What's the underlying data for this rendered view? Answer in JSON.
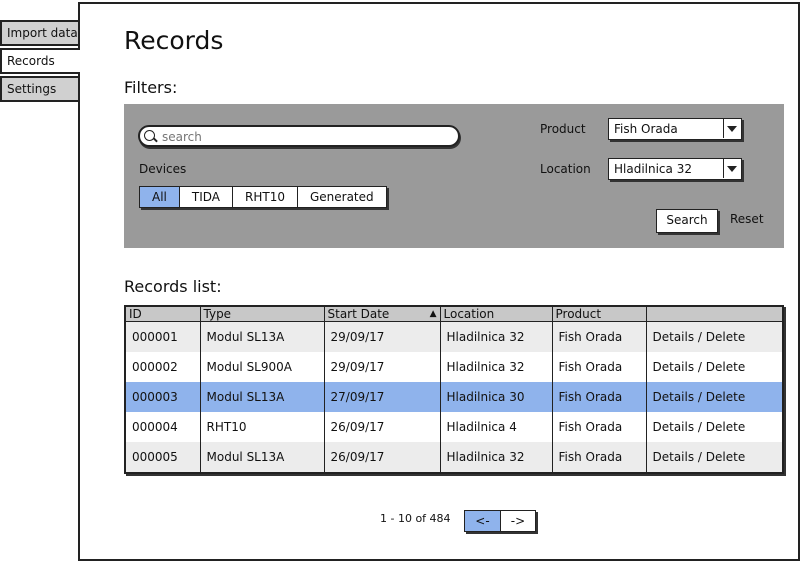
{
  "nav": {
    "tabs": [
      {
        "label": "Import data"
      },
      {
        "label": "Records"
      },
      {
        "label": "Settings"
      }
    ]
  },
  "page": {
    "title": "Records"
  },
  "filters": {
    "heading": "Filters:",
    "search_placeholder": "search",
    "devices_label": "Devices",
    "devices": [
      "All",
      "TIDA",
      "RHT10",
      "Generated"
    ],
    "product_label": "Product",
    "product_value": "Fish Orada",
    "location_label": "Location",
    "location_value": "Hladilnica 32",
    "search_button": "Search",
    "reset_button": "Reset"
  },
  "records": {
    "heading": "Records list:",
    "columns": [
      "ID",
      "Type",
      "Start Date",
      "Location",
      "Product",
      ""
    ],
    "rows": [
      {
        "id": "000001",
        "type": "Modul SL13A",
        "start": "29/09/17",
        "location": "Hladilnica 32",
        "product": "Fish Orada",
        "actions": "Details / Delete"
      },
      {
        "id": "000002",
        "type": "Modul SL900A",
        "start": "29/09/17",
        "location": "Hladilnica 32",
        "product": "Fish Orada",
        "actions": "Details / Delete"
      },
      {
        "id": "000003",
        "type": "Modul SL13A",
        "start": "27/09/17",
        "location": "Hladilnica 30",
        "product": "Fish Orada",
        "actions": "Details / Delete"
      },
      {
        "id": "000004",
        "type": "RHT10",
        "start": "26/09/17",
        "location": "Hladilnica 4",
        "product": "Fish Orada",
        "actions": "Details / Delete"
      },
      {
        "id": "000005",
        "type": "Modul SL13A",
        "start": "26/09/17",
        "location": "Hladilnica 32",
        "product": "Fish Orada",
        "actions": "Details / Delete"
      }
    ],
    "selected_row_index": 2
  },
  "pagination": {
    "summary": "1 - 10 of 484",
    "prev": "<-",
    "next": "->"
  },
  "colors": {
    "accent": "#8fb3ec",
    "panel": "#9a9a9a"
  }
}
